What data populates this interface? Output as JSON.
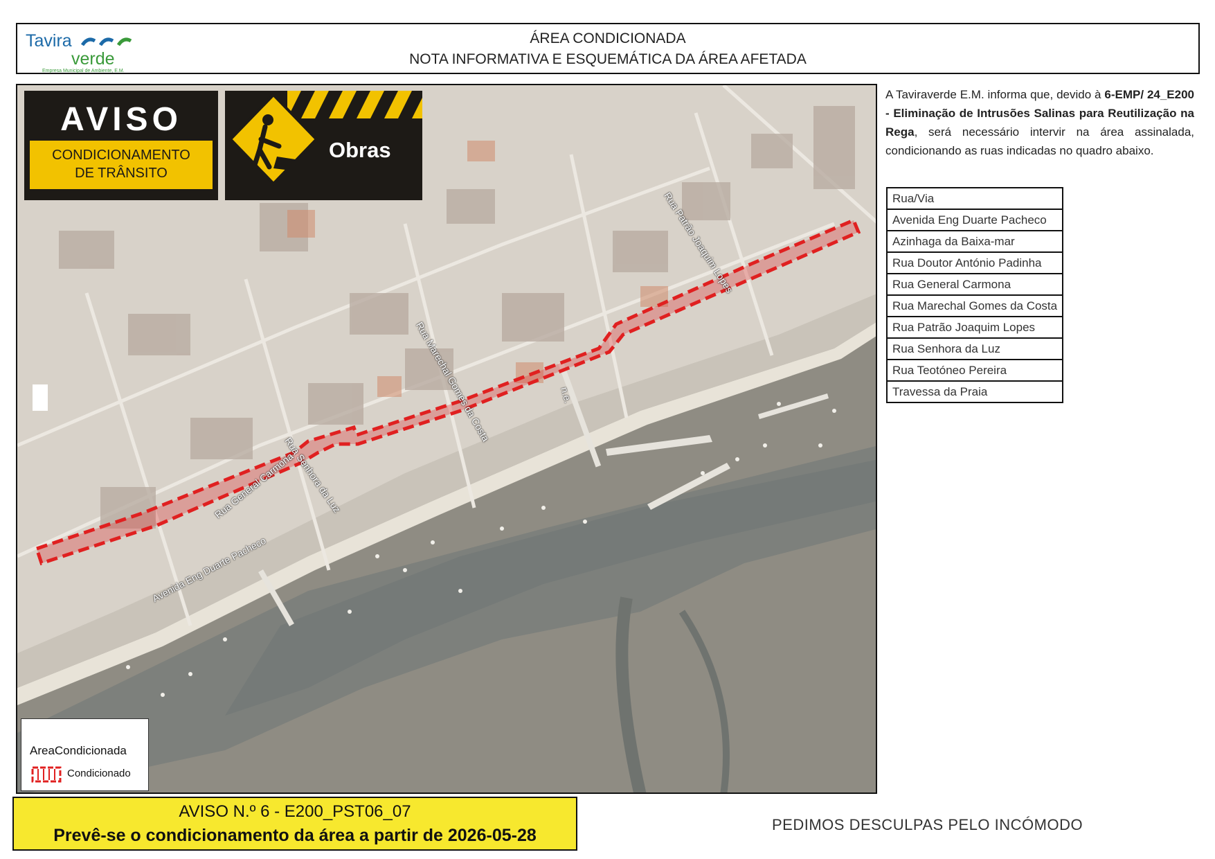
{
  "header": {
    "logo_line1": "Tavira",
    "logo_line2": "verde",
    "logo_sub": "Empresa Municipal de Ambiente, E.M.",
    "title_line1": "ÁREA CONDICIONADA",
    "title_line2": "NOTA INFORMATIVA E ESQUEMÁTICA DA ÁREA AFETADA"
  },
  "signs": {
    "aviso_title": "AVISO",
    "aviso_line1": "CONDICIONAMENTO",
    "aviso_line2": "DE TRÂNSITO",
    "obras_label": "Obras"
  },
  "map_labels": {
    "patrao": "Rua Patrão Joaquim Lopes",
    "marechal": "Rua Marechal Gomes da Costa",
    "ne": "n.e.",
    "carmona": "Rua General Carmona",
    "senhora": "Rua Senhora da Luz",
    "duarte": "Avenida Eng Duarte Pacheco"
  },
  "legend": {
    "title": "AreaCondicionada",
    "item": "Condicionado",
    "color": "#e02020"
  },
  "info": {
    "p1": "A Taviraverde E.M. informa que, devido à ",
    "bold": "6-EMP/ 24_E200 - Eliminação de Intrusões Salinas para Reutilização na Rega",
    "p2": ", será necessário intervir na área assinalada, condicionando as ruas indicadas no quadro abaixo."
  },
  "streets_table": [
    "Rua/Via",
    "Avenida Eng Duarte Pacheco",
    "Azinhaga da Baixa-mar",
    "Rua Doutor António Padinha",
    "Rua General Carmona",
    "Rua Marechal Gomes da Costa",
    "Rua Patrão Joaquim Lopes",
    "Rua Senhora da Luz",
    "Rua Teotóneo Pereira",
    "Travessa da Praia"
  ],
  "footer": {
    "notice": "AVISO N.º 6 - E200_PST06_07",
    "forecast": "Prevê-se o condicionamento da área a partir de 2026-05-28",
    "apology": "PEDIMOS DESCULPAS PELO INCÓMODO"
  },
  "colors": {
    "sign_yellow": "#f2c200",
    "footer_yellow": "#f7e82e",
    "brand_blue": "#1c6aa8",
    "brand_green": "#3a9a3a"
  }
}
